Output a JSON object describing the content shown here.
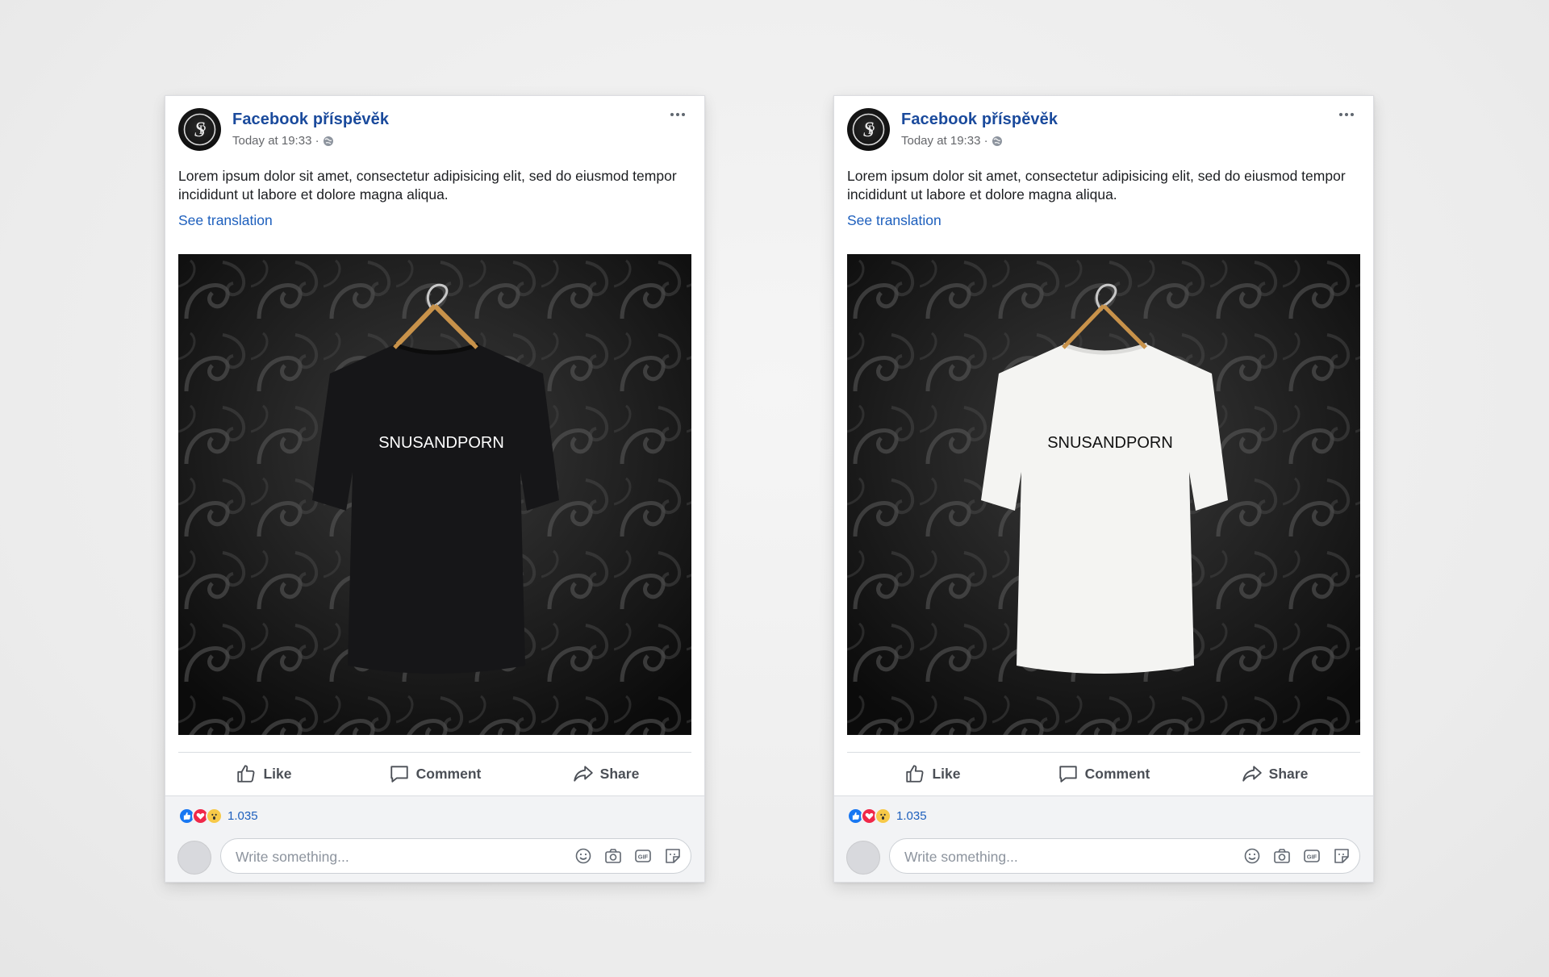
{
  "posts": [
    {
      "id": "left",
      "page_name": "Facebook příspěvěk",
      "timestamp": "Today at 19:33 ·",
      "text": "Lorem ipsum dolor sit amet, consectetur adipisicing elit, sed do eiusmod tempor incididunt ut labore et dolore magna aliqua.",
      "see_translation": "See translation",
      "shirt_color": "#161618",
      "shirt_text": "SNUSANDPORN",
      "shirt_text_color": "#ffffff",
      "actions": {
        "like": "Like",
        "comment": "Comment",
        "share": "Share"
      },
      "reaction_count": "1.035",
      "comment_placeholder": "Write something..."
    },
    {
      "id": "right",
      "page_name": "Facebook příspěvěk",
      "timestamp": "Today at 19:33 ·",
      "text": "Lorem ipsum dolor sit amet, consectetur adipisicing elit, sed do eiusmod tempor incididunt ut labore et dolore magna aliqua.",
      "see_translation": "See translation",
      "shirt_color": "#f4f4f2",
      "shirt_text": "SNUSANDPORN",
      "shirt_text_color": "#111111",
      "actions": {
        "like": "Like",
        "comment": "Comment",
        "share": "Share"
      },
      "reaction_count": "1.035",
      "comment_placeholder": "Write something..."
    }
  ],
  "icons": [
    "more-icon",
    "globe-icon",
    "like-icon",
    "comment-icon",
    "share-icon",
    "emoji-icon",
    "camera-icon",
    "gif-icon",
    "sticker-icon"
  ],
  "colors": {
    "link": "#1d5fbd",
    "page_name": "#1a4a9c",
    "like": "#1877f2",
    "love": "#f02849",
    "wow": "#f7c948"
  }
}
